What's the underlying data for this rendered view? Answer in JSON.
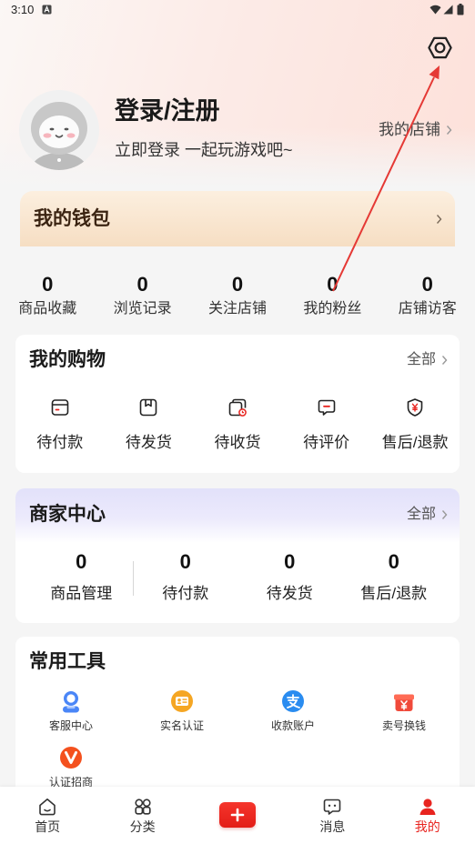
{
  "status_bar": {
    "time": "3:10",
    "icons": [
      "a-notification-icon",
      "wifi-icon",
      "signal-icon",
      "battery-icon"
    ]
  },
  "header": {
    "settings_icon": "settings-icon",
    "avatar_icon": "default-avatar-icon",
    "login_title": "登录/注册",
    "login_subtitle": "立即登录 一起玩游戏吧~",
    "my_shop_label": "我的店铺"
  },
  "wallet": {
    "title": "我的钱包"
  },
  "stats": [
    {
      "value": "0",
      "label": "商品收藏"
    },
    {
      "value": "0",
      "label": "浏览记录"
    },
    {
      "value": "0",
      "label": "关注店铺"
    },
    {
      "value": "0",
      "label": "我的粉丝"
    },
    {
      "value": "0",
      "label": "店铺访客"
    }
  ],
  "shopping": {
    "title": "我的购物",
    "all_label": "全部",
    "items": [
      {
        "label": "待付款",
        "icon": "pending-payment-icon"
      },
      {
        "label": "待发货",
        "icon": "pending-shipment-icon"
      },
      {
        "label": "待收货",
        "icon": "pending-receipt-icon"
      },
      {
        "label": "待评价",
        "icon": "pending-review-icon"
      },
      {
        "label": "售后/退款",
        "icon": "after-sales-refund-icon"
      }
    ]
  },
  "merchant": {
    "title": "商家中心",
    "all_label": "全部",
    "items": [
      {
        "value": "0",
        "label": "商品管理"
      },
      {
        "value": "0",
        "label": "待付款"
      },
      {
        "value": "0",
        "label": "待发货"
      },
      {
        "value": "0",
        "label": "售后/退款"
      }
    ]
  },
  "tools": {
    "title": "常用工具",
    "items": [
      {
        "label": "客服中心",
        "icon": "customer-service-icon",
        "color": "#4a86f7"
      },
      {
        "label": "实名认证",
        "icon": "id-verification-icon",
        "color": "#f5a623"
      },
      {
        "label": "收款账户",
        "icon": "alipay-account-icon",
        "color": "#2a8cf0"
      },
      {
        "label": "卖号换钱",
        "icon": "sell-account-icon",
        "color": "#f04a3a"
      },
      {
        "label": "认证招商",
        "icon": "merchant-verified-icon",
        "color": "#f4511e"
      }
    ]
  },
  "bottom_nav": {
    "items": [
      {
        "label": "首页",
        "icon": "home-icon"
      },
      {
        "label": "分类",
        "icon": "category-icon"
      },
      {
        "icon": "publish-plus-icon"
      },
      {
        "label": "消息",
        "icon": "message-icon"
      },
      {
        "label": "我的",
        "icon": "profile-icon",
        "active": true
      }
    ]
  },
  "colors": {
    "accent": "#e8241f",
    "page_background": "#f5f5f5",
    "wallet_text": "#3b2412",
    "annotation_arrow": "#e53935"
  }
}
